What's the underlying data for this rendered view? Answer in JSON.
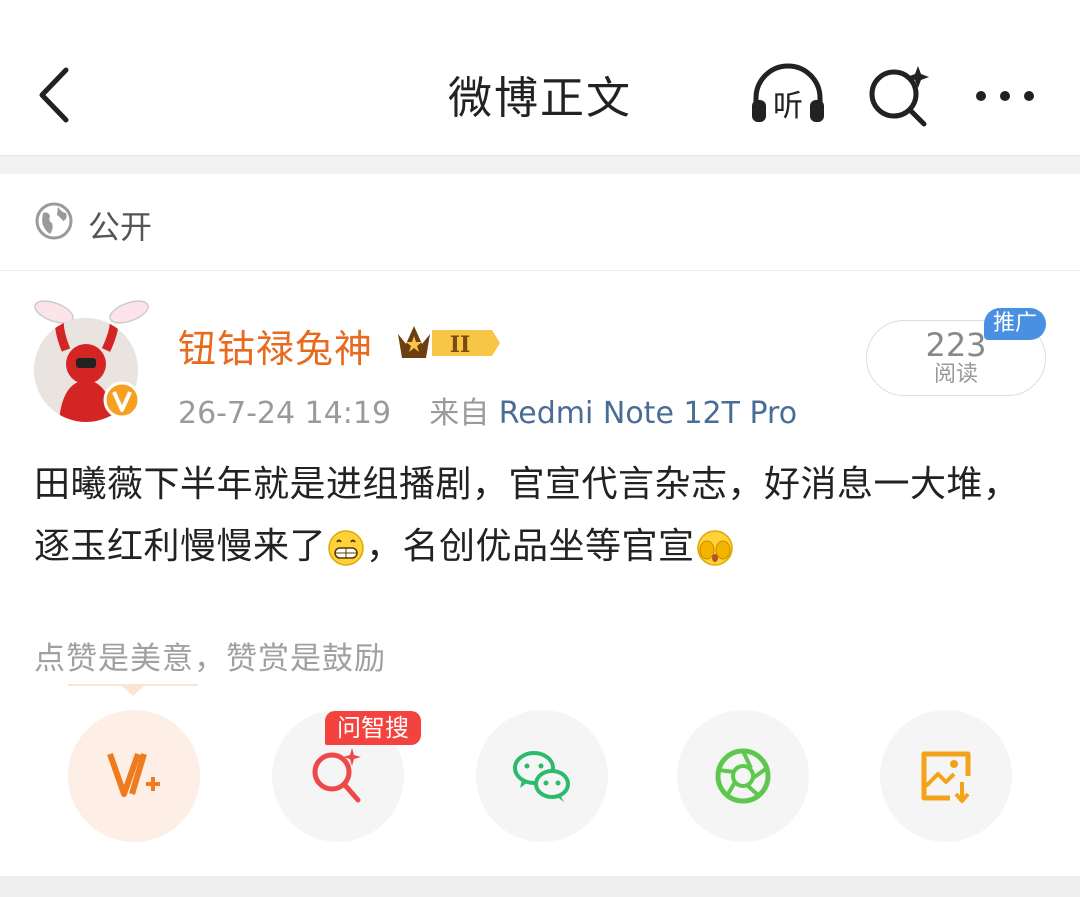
{
  "nav": {
    "title": "微博正文",
    "listen_label": "听"
  },
  "visibility": {
    "label": "公开",
    "icon": "globe-icon"
  },
  "post": {
    "username": "钮钴禄兔神",
    "member_level": "II",
    "time": "26-7-24 14:19",
    "source_prefix": "来自",
    "device": "Redmi Note 12T Pro",
    "read_count": "223",
    "read_label": "阅读",
    "promo_label": "推广",
    "text_part1": "田曦薇下半年就是进组播剧，官宣代言杂志，好消息一大堆，逐玉红利慢慢来了",
    "text_part2": "，名创优品坐等官宣"
  },
  "tip": "点赞是美意，赞赏是鼓励",
  "actions": [
    {
      "name": "vip",
      "icon": "v-plus-icon",
      "color": "#f07b1f"
    },
    {
      "name": "ai-search",
      "icon": "ai-search-icon",
      "badge": "问智搜",
      "color": "#f04848"
    },
    {
      "name": "wechat",
      "icon": "wechat-icon",
      "color": "#2cba6c"
    },
    {
      "name": "moments",
      "icon": "moments-icon",
      "color": "#5ec84e"
    },
    {
      "name": "save-image",
      "icon": "save-image-icon",
      "color": "#f4a21a"
    }
  ],
  "colors": {
    "username": "#e86a1e",
    "device": "#4a6d96",
    "promo": "#4a90e2",
    "ai_badge": "#f4423f"
  }
}
